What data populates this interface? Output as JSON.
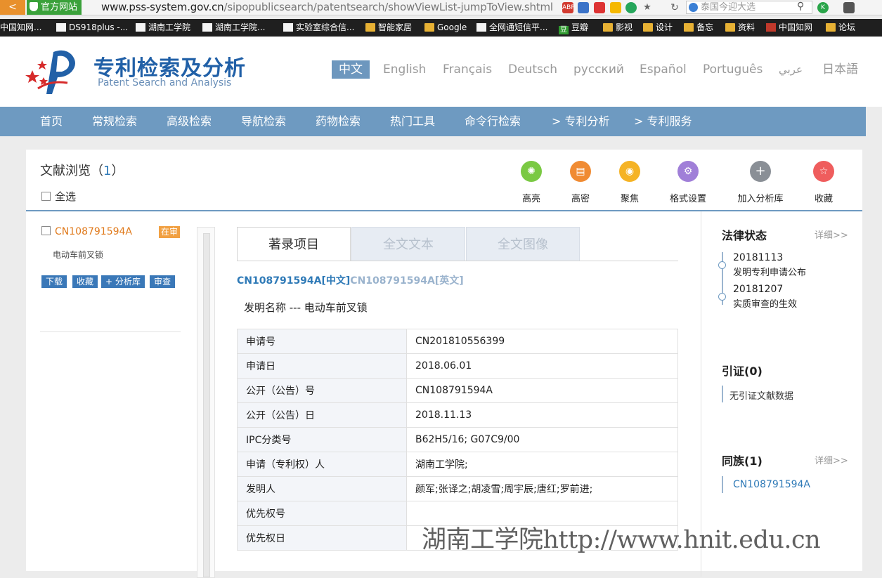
{
  "browser": {
    "back_label": "<",
    "site_badge": "官方网站",
    "url_host": "www.pss-system.gov.cn",
    "url_path": "/sipopublicsearch/patentsearch/showViewList-jumpToView.shtml",
    "search_placeholder": "泰国今迎大选",
    "search_icon": "search-icon"
  },
  "bookmarks": [
    "中国知网...",
    "DS918plus -...",
    "湖南工学院",
    "湖南工学院...",
    "实验室综合信...",
    "智能家居",
    "Google",
    "全网通短信平...",
    "豆瓣",
    "影视",
    "设计",
    "备忘",
    "资料",
    "中国知网",
    "论坛"
  ],
  "header": {
    "title_cn": "专利检索及分析",
    "title_en": "Patent Search and Analysis",
    "languages": [
      "中文",
      "English",
      "Français",
      "Deutsch",
      "русский",
      "Español",
      "Português",
      "عربي",
      "日本語"
    ]
  },
  "nav": [
    "首页",
    "常规检索",
    "高级检索",
    "导航检索",
    "药物检索",
    "热门工具",
    "命令行检索",
    "> 专利分析",
    "> 专利服务"
  ],
  "browse": {
    "title": "文献浏览（",
    "count": "1",
    "title_end": "）",
    "select_all": "全选"
  },
  "toolbar": [
    {
      "label": "高亮",
      "color": "#7ac943",
      "icon": "lightbulb-icon"
    },
    {
      "label": "高密",
      "color": "#f08b33",
      "icon": "document-icon"
    },
    {
      "label": "聚焦",
      "color": "#f5b325",
      "icon": "eye-icon"
    },
    {
      "label": "格式设置",
      "color": "#a07fd8",
      "icon": "gear-icon"
    },
    {
      "label": "加入分析库",
      "color": "#8a8f96",
      "icon": "plus-icon"
    },
    {
      "label": "收藏",
      "color": "#ef5d5d",
      "icon": "star-icon"
    }
  ],
  "doc": {
    "number": "CN108791594A",
    "status": "在审",
    "name": "电动车前叉锁",
    "actions": [
      "下载",
      "收藏",
      "+ 分析库",
      "审查"
    ]
  },
  "tabs": [
    "著录项目",
    "全文文本",
    "全文图像"
  ],
  "pub": {
    "cn_no": "CN108791594A",
    "cn_tag": "[中文]",
    "en_no": "CN108791594A",
    "en_tag": "[英文]"
  },
  "invention_title": "发明名称 --- 电动车前叉锁",
  "biblio": [
    [
      "申请号",
      "CN201810556399"
    ],
    [
      "申请日",
      "2018.06.01"
    ],
    [
      "公开（公告）号",
      "CN108791594A"
    ],
    [
      "公开（公告）日",
      "2018.11.13"
    ],
    [
      "IPC分类号",
      "B62H5/16; G07C9/00"
    ],
    [
      "申请（专利权）人",
      "湖南工学院;"
    ],
    [
      "发明人",
      "颜军;张译之;胡凌雪;周宇辰;唐红;罗前进;"
    ],
    [
      "优先权号",
      ""
    ],
    [
      "优先权日",
      ""
    ]
  ],
  "legal": {
    "title": "法律状态",
    "more": "详细>>",
    "events": [
      {
        "date": "20181113",
        "label": "发明专利申请公布"
      },
      {
        "date": "20181207",
        "label": "实质审查的生效"
      }
    ]
  },
  "citation": {
    "title": "引证(0)",
    "empty": "无引证文献数据"
  },
  "family": {
    "title": "同族(1)",
    "more": "详细>>",
    "items": [
      "CN108791594A"
    ]
  },
  "watermark": "湖南工学院http://www.hnit.edu.cn"
}
